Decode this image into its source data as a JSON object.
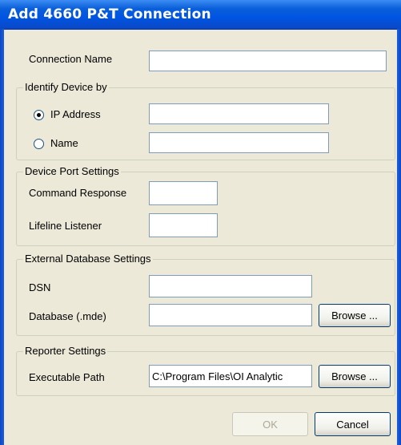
{
  "window": {
    "title": "Add 4660 P&T Connection"
  },
  "connection_name": {
    "label": "Connection Name",
    "value": ""
  },
  "identify_device": {
    "legend": "Identify Device by",
    "ip_address": {
      "label": "IP Address",
      "selected": true,
      "value": ""
    },
    "name": {
      "label": "Name",
      "selected": false,
      "value": ""
    }
  },
  "device_port": {
    "legend": "Device Port Settings",
    "command_response": {
      "label": "Command Response",
      "value": ""
    },
    "lifeline_listener": {
      "label": "Lifeline Listener",
      "value": ""
    }
  },
  "external_db": {
    "legend": "External Database Settings",
    "dsn": {
      "label": "DSN",
      "value": ""
    },
    "database": {
      "label": "Database (.mde)",
      "value": ""
    },
    "browse_label": "Browse ..."
  },
  "reporter": {
    "legend": "Reporter Settings",
    "executable_path": {
      "label": "Executable Path",
      "value": "C:\\Program Files\\OI Analytic"
    },
    "browse_label": "Browse ..."
  },
  "buttons": {
    "ok": "OK",
    "cancel": "Cancel"
  },
  "colors": {
    "titlebar": "#0054e3",
    "dialog_bg": "#ece9d8",
    "field_border": "#7f9db9",
    "button_border": "#003c74"
  }
}
